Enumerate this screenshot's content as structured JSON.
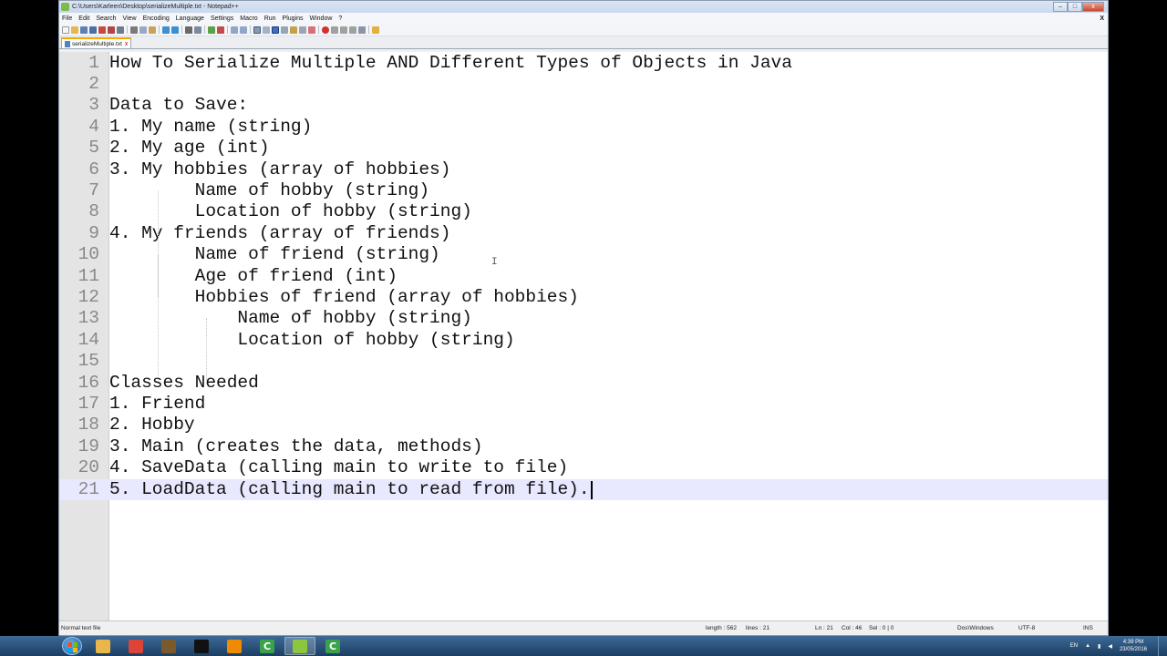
{
  "window": {
    "title": "C:\\Users\\Karleen\\Desktop\\serializeMultiple.txt - Notepad++",
    "buttons": {
      "minimize": "–",
      "maximize": "□",
      "close": "x"
    }
  },
  "menu": [
    "File",
    "Edit",
    "Search",
    "View",
    "Encoding",
    "Language",
    "Settings",
    "Macro",
    "Run",
    "Plugins",
    "Window",
    "?"
  ],
  "menu_close": "X",
  "tab": {
    "label": "serializeMultiple.txt",
    "close": "x"
  },
  "editor": {
    "lines": [
      {
        "num": "1",
        "text": "How To Serialize Multiple AND Different Types of Objects in Java"
      },
      {
        "num": "2",
        "text": ""
      },
      {
        "num": "3",
        "text": "Data to Save:"
      },
      {
        "num": "4",
        "text": "1. My name (string)"
      },
      {
        "num": "5",
        "text": "2. My age (int)"
      },
      {
        "num": "6",
        "text": "3. My hobbies (array of hobbies)"
      },
      {
        "num": "7",
        "text": "        Name of hobby (string)"
      },
      {
        "num": "8",
        "text": "        Location of hobby (string)"
      },
      {
        "num": "9",
        "text": "4. My friends (array of friends)"
      },
      {
        "num": "10",
        "text": "        Name of friend (string)"
      },
      {
        "num": "11",
        "text": "        Age of friend (int)"
      },
      {
        "num": "12",
        "text": "        Hobbies of friend (array of hobbies)"
      },
      {
        "num": "13",
        "text": "            Name of hobby (string)"
      },
      {
        "num": "14",
        "text": "            Location of hobby (string)"
      },
      {
        "num": "15",
        "text": ""
      },
      {
        "num": "16",
        "text": "Classes Needed"
      },
      {
        "num": "17",
        "text": "1. Friend"
      },
      {
        "num": "18",
        "text": "2. Hobby"
      },
      {
        "num": "19",
        "text": "3. Main (creates the data, methods)"
      },
      {
        "num": "20",
        "text": "4. SaveData (calling main to write to file)"
      },
      {
        "num": "21",
        "text": "5. LoadData (calling main to read from file)."
      }
    ],
    "current_line": 21,
    "cursor_glyph": "I"
  },
  "status": {
    "file_type": "Normal text file",
    "length": "length : 562",
    "lines": "lines : 21",
    "ln": "Ln : 21",
    "col": "Col : 46",
    "sel": "Sel : 0 | 0",
    "eol": "Dos\\Windows",
    "encoding": "UTF-8",
    "mode": "INS"
  },
  "taskbar": {
    "apps": [
      {
        "name": "explorer",
        "glyph": "",
        "color": "#e8b64a"
      },
      {
        "name": "chrome",
        "glyph": "",
        "color": "#db4437"
      },
      {
        "name": "game",
        "glyph": "",
        "color": "#7a5a2a"
      },
      {
        "name": "cmd",
        "glyph": "",
        "color": "#111111"
      },
      {
        "name": "vlc",
        "glyph": "",
        "color": "#f08a00"
      },
      {
        "name": "camtasia",
        "glyph": "C",
        "color": "#3aa34a"
      },
      {
        "name": "notepad-plus-plus",
        "glyph": "",
        "color": "#8cc63e"
      },
      {
        "name": "camtasia-recorder",
        "glyph": "C",
        "color": "#3aa34a"
      }
    ],
    "language": "EN",
    "time": "4:39 PM",
    "date": "23/05/2016"
  }
}
